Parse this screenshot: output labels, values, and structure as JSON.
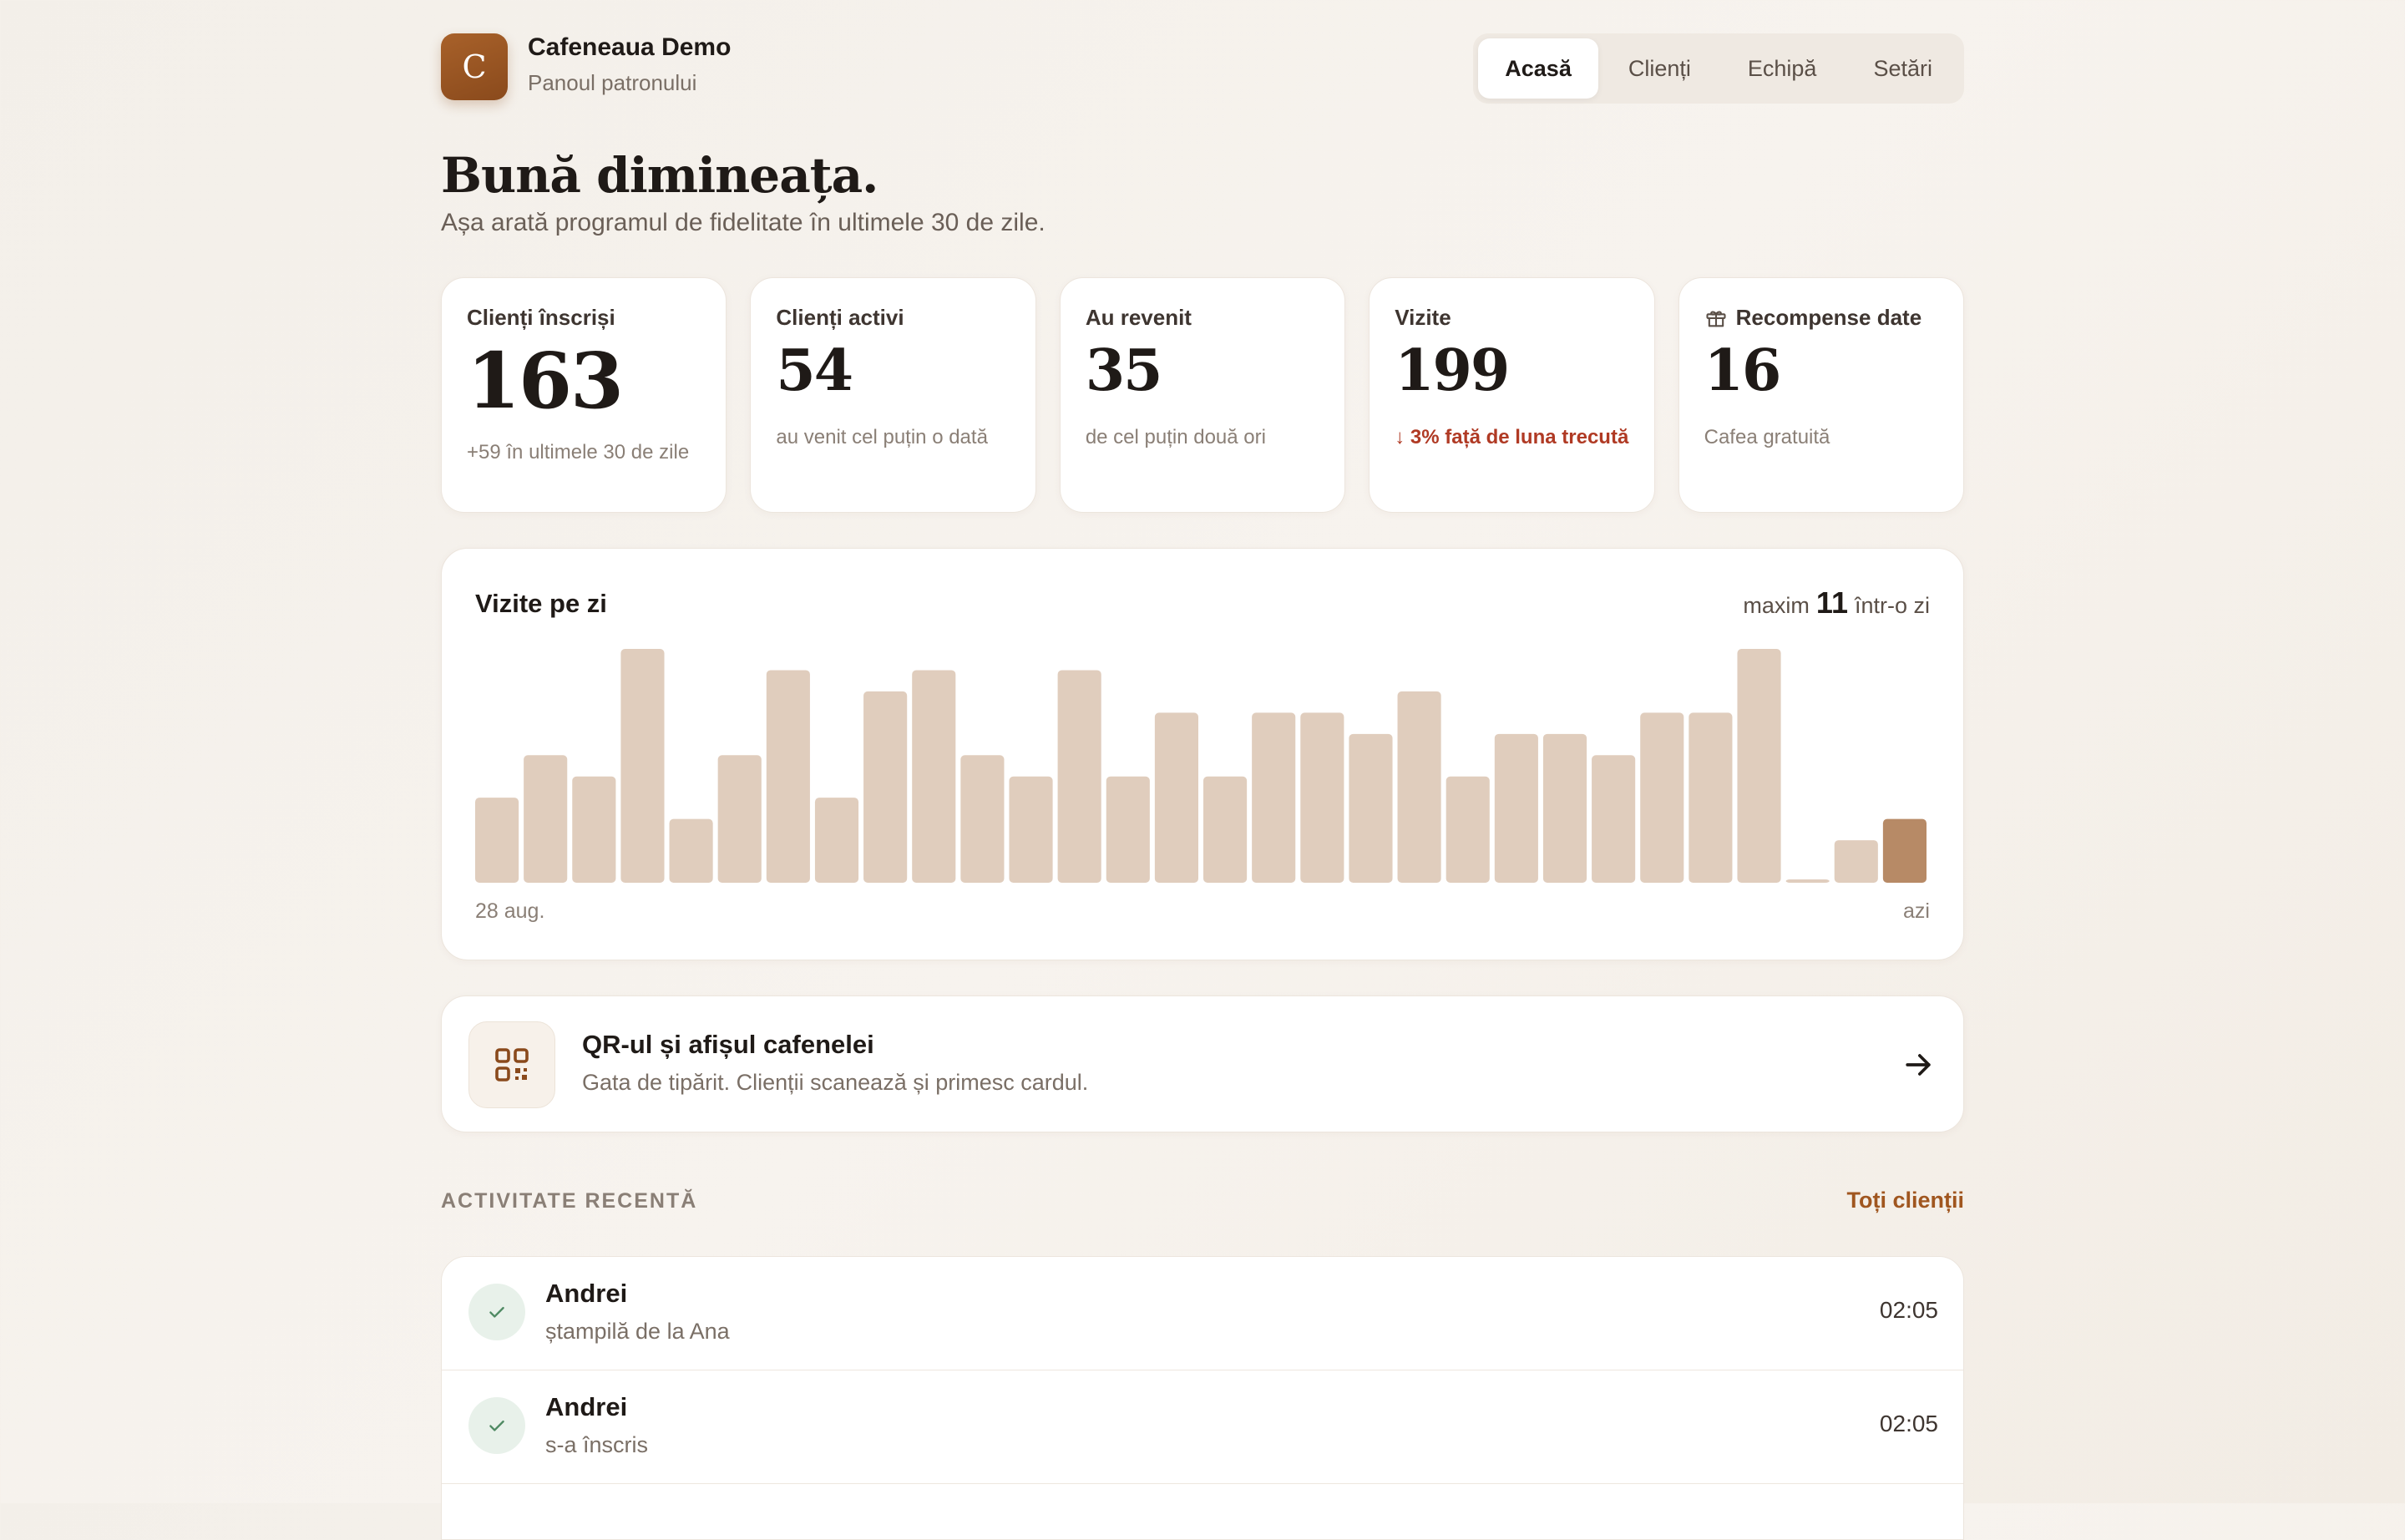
{
  "brand": {
    "logo_letter": "C",
    "name": "Cafeneaua Demo",
    "subtitle": "Panoul patronului"
  },
  "nav": {
    "tabs": [
      {
        "label": "Acasă",
        "active": true
      },
      {
        "label": "Clienți",
        "active": false
      },
      {
        "label": "Echipă",
        "active": false
      },
      {
        "label": "Setări",
        "active": false
      }
    ]
  },
  "greeting": {
    "title": "Bună dimineața.",
    "subtitle": "Așa arată programul de fidelitate în ultimele 30 de zile."
  },
  "stats": [
    {
      "label": "Clienți înscriși",
      "value": "163",
      "note": "+59 în ultimele 30 de zile"
    },
    {
      "label": "Clienți activi",
      "value": "54",
      "note": "au venit cel puțin o dată"
    },
    {
      "label": "Au revenit",
      "value": "35",
      "note": "de cel puțin două ori"
    },
    {
      "label": "Vizite",
      "value": "199",
      "note": "↓ 3% față de luna trecută"
    },
    {
      "label": "Recompense date",
      "value": "16",
      "note": "Cafea gratuită",
      "icon": "gift-icon"
    }
  ],
  "chart_data": {
    "type": "bar",
    "title": "Vizite pe zi",
    "max_label": "maxim",
    "max_value": "11",
    "max_suffix": "într-o zi",
    "start_label": "28 aug.",
    "end_label": "azi",
    "ylim": [
      0,
      11
    ],
    "values": [
      4,
      6,
      5,
      11,
      3,
      6,
      10,
      4,
      9,
      10,
      6,
      5,
      10,
      5,
      8,
      5,
      8,
      8,
      7,
      9,
      5,
      7,
      7,
      6,
      8,
      8,
      11,
      0,
      2,
      3
    ],
    "colors": {
      "bar": "#e0cdbd",
      "today": "#b78a66"
    }
  },
  "qr": {
    "title": "QR-ul și afișul cafenelei",
    "subtitle": "Gata de tipărit. Clienții scanează și primesc cardul."
  },
  "activity": {
    "heading": "ACTIVITATE RECENTĂ",
    "link": "Toți clienții",
    "items": [
      {
        "name": "Andrei",
        "desc": "ștampilă de la Ana",
        "time": "02:05"
      },
      {
        "name": "Andrei",
        "desc": "s-a înscris",
        "time": "02:05"
      }
    ]
  }
}
